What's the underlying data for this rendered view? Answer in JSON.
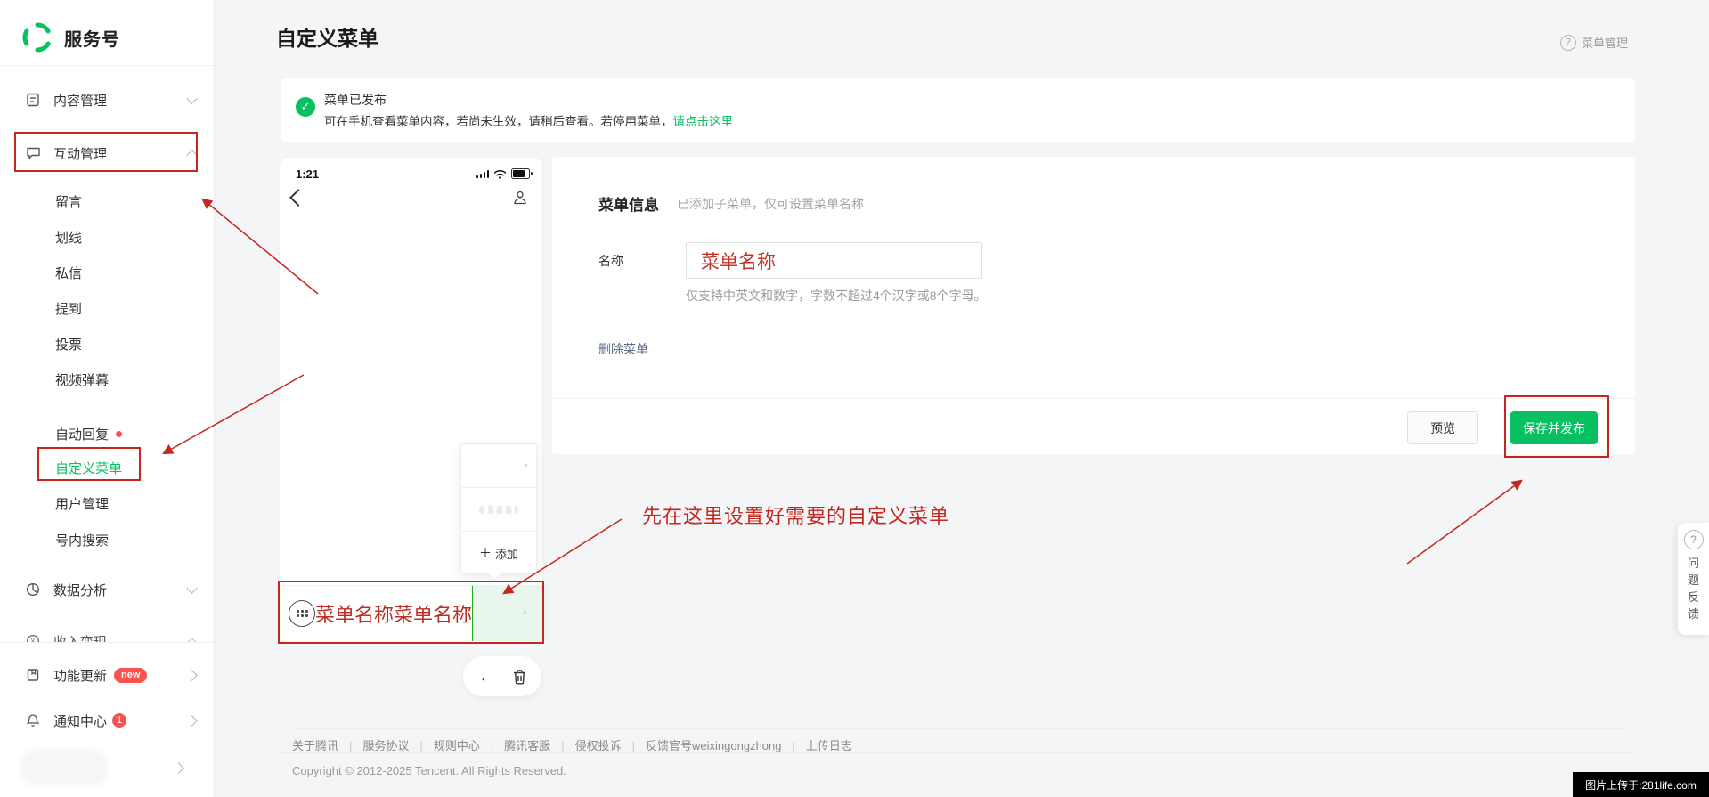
{
  "brand": {
    "name": "服务号"
  },
  "icons": {
    "back_arrow": "←",
    "plus": "＋",
    "check": "✓",
    "question": "?",
    "yen": "¥"
  },
  "sidebar": {
    "items": [
      {
        "label": "内容管理"
      },
      {
        "label": "互动管理"
      },
      {
        "label": "留言"
      },
      {
        "label": "划线"
      },
      {
        "label": "私信"
      },
      {
        "label": "提到"
      },
      {
        "label": "投票"
      },
      {
        "label": "视频弹幕"
      },
      {
        "label": "自动回复"
      },
      {
        "label": "自定义菜单"
      },
      {
        "label": "用户管理"
      },
      {
        "label": "号内搜索"
      },
      {
        "label": "数据分析"
      },
      {
        "label": "收入变现"
      },
      {
        "label": "功能更新",
        "badge": "new"
      },
      {
        "label": "通知中心",
        "badge": "1"
      }
    ]
  },
  "header": {
    "title": "自定义菜单",
    "help_label": "菜单管理"
  },
  "notice": {
    "title": "菜单已发布",
    "body": "可在手机查看菜单内容，若尚未生效，请稍后查看。若停用菜单，",
    "link_label": "请点击这里"
  },
  "phone": {
    "time": "1:21",
    "popup": {
      "add_label": "添加"
    },
    "menu_bar": {
      "items": [
        {
          "label": "菜单名称"
        },
        {
          "label": "菜单名称"
        }
      ]
    }
  },
  "form": {
    "section_title": "菜单信息",
    "section_hint": "已添加子菜单，仅可设置菜单名称",
    "name_label": "名称",
    "name_value": "菜单名称",
    "name_hint": "仅支持中英文和数字，字数不超过4个汉字或8个字母。",
    "delete_link": "删除菜单",
    "preview_button": "预览",
    "save_button": "保存并发布"
  },
  "annotation": {
    "tip_text": "先在这里设置好需要的自定义菜单"
  },
  "footer": {
    "links": [
      {
        "label": "关于腾讯"
      },
      {
        "label": "服务协议"
      },
      {
        "label": "规则中心"
      },
      {
        "label": "腾讯客服"
      },
      {
        "label": "侵权投诉"
      },
      {
        "label": "反馈官号weixingongzhong"
      },
      {
        "label": "上传日志"
      }
    ],
    "copyright": "Copyright © 2012-2025 Tencent. All Rights Reserved."
  },
  "feedback": {
    "label": "问题反馈"
  },
  "watermark": {
    "text": "图片上传于:281life.com"
  },
  "colors": {
    "accent": "#07c160",
    "annotation_red": "#c5261f",
    "badge_red": "#fa5151",
    "link_blue": "#5a6a8a"
  }
}
